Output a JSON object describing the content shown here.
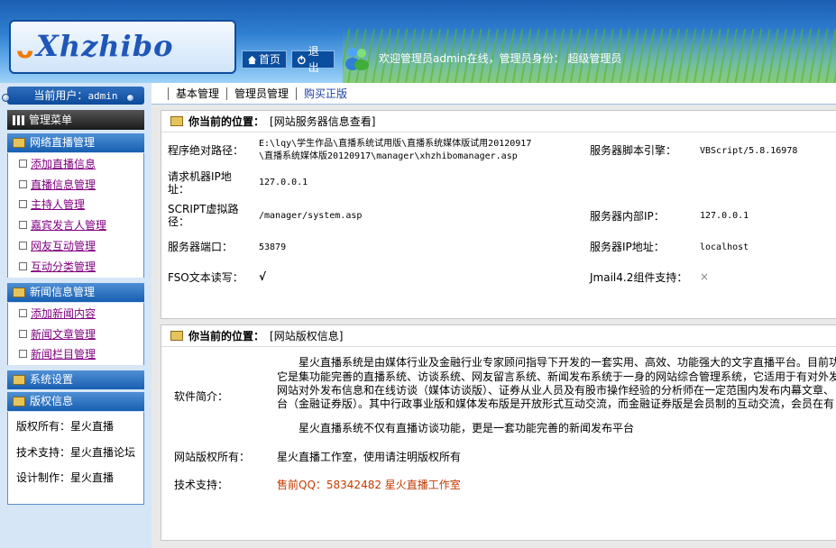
{
  "header": {
    "logo": "Xhzhibo",
    "home_label": "首页",
    "exit_label": "退出",
    "welcome": "欢迎管理员admin在线，管理员身份：  超级管理员"
  },
  "sidebar": {
    "current_user_label": "当前用户：",
    "current_user": "admin",
    "menu_title": "管理菜单",
    "sections": [
      {
        "title": "网络直播管理",
        "items": [
          "添加直播信息",
          "直播信息管理",
          "主持人管理",
          "嘉宾发言人管理",
          "网友互动管理",
          "互动分类管理"
        ]
      },
      {
        "title": "新闻信息管理",
        "items": [
          "添加新闻内容",
          "新闻文章管理",
          "新闻栏目管理"
        ]
      },
      {
        "title": "系统设置",
        "items": []
      },
      {
        "title": "版权信息",
        "items": []
      }
    ],
    "copyright": {
      "owner": "版权所有：星火直播",
      "support": "技术支持：星火直播论坛",
      "design": "设计制作：星火直播"
    }
  },
  "tabs": [
    "基本管理",
    "管理员管理",
    "购买正版"
  ],
  "server_panel": {
    "location_label": "你当前的位置：",
    "location": "[网站服务器信息查看]",
    "rows": {
      "path_label": "程序绝对路径：",
      "path_line1": "E:\\lqy\\学生作品\\直播系统试用版\\直播系统媒体版试用20120917",
      "path_line2": "\\直播系统媒体版20120917\\manager\\xhzhibomanager.asp",
      "engine_label": "服务器脚本引擎：",
      "engine": "VBScript/5.8.16978",
      "client_ip_label": "请求机器IP地址：",
      "client_ip": "127.0.0.1",
      "script_label": "SCRIPT虚拟路径：",
      "script": "/manager/system.asp",
      "inner_ip_label": "服务器内部IP：",
      "inner_ip": "127.0.0.1",
      "port_label": "服务器端口：",
      "port": "53879",
      "server_ip_label": "服务器IP地址：",
      "server_ip": "localhost",
      "fso_label": "FSO文本读写：",
      "fso": "√",
      "jmail_label": "Jmail4.2组件支持：",
      "jmail": "×"
    }
  },
  "copyright_panel": {
    "location_label": "你当前的位置：",
    "location": "[网站版权信息]",
    "intro_label": "软件简介：",
    "intro_lines": [
      "星火直播系统是由媒体行业及金融行业专家顾问指导下开发的一套实用、高效、功能强大的文字直播平台。目前功",
      "它是集功能完善的直播系统、访谈系统、网友留言系统、新闻发布系统于一身的网站综合管理系统，它适用于有对外发",
      "网站对外发布信息和在线访谈（媒体访谈版）、证券从业人员及有股市操作经验的分析师在一定范围内发布内幕文章、",
      "台（金融证券版）。其中行政事业版和媒体发布版是开放形式互动交流，而金融证券版是会员制的互动交流，会员在有"
    ],
    "intro_extra": "星火直播系统不仅有直播访谈功能，更是一套功能完善的新闻发布平台",
    "owner_label": "网站版权所有：",
    "owner": "星火直播工作室，使用请注明版权所有",
    "support_label": "技术支持：",
    "support": "售前QQ：58342482 星火直播工作室"
  },
  "colors": {
    "header_blue": "#1b5fb3",
    "link_purple": "#800080",
    "support_red": "#c43a00"
  }
}
